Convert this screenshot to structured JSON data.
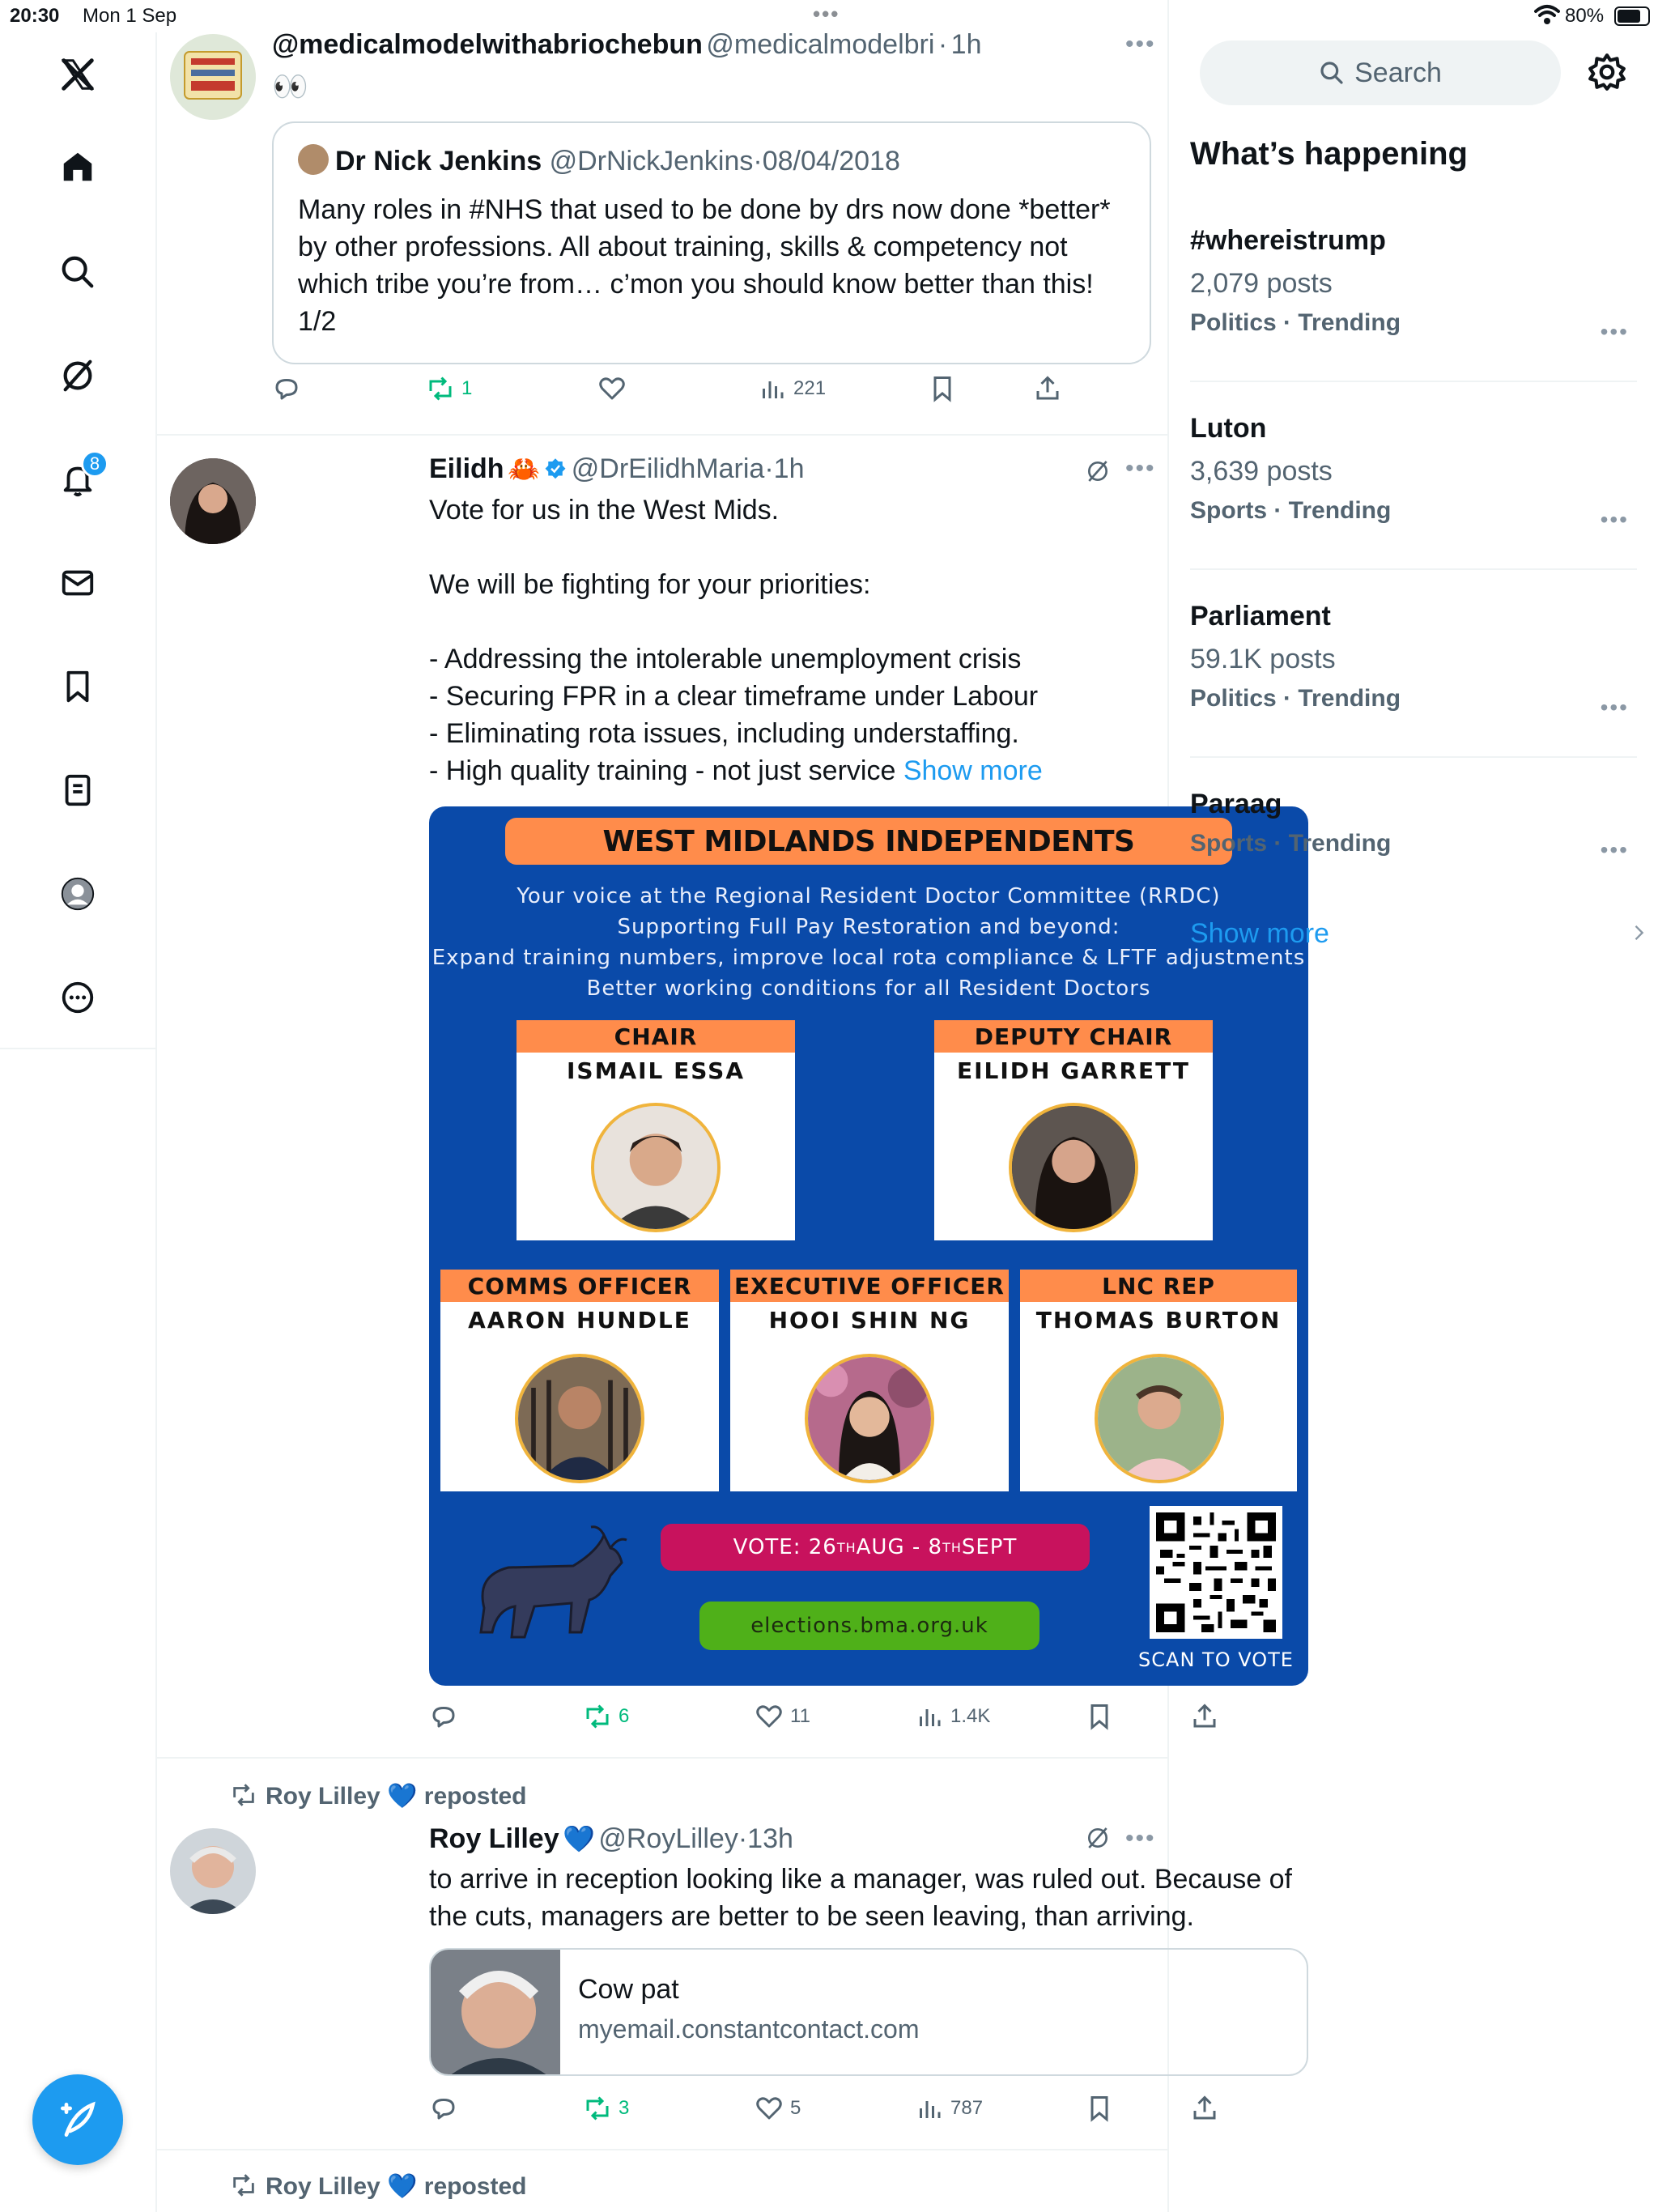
{
  "status": {
    "time": "20:30",
    "date": "Mon 1 Sep",
    "battery_pct": "80%",
    "battery_level": 0.8
  },
  "nav": {
    "notif_count": "8",
    "icons": [
      "x-logo-icon",
      "home-icon",
      "search-icon",
      "grok-icon",
      "bell-icon",
      "mail-icon",
      "bookmark-icon",
      "lists-icon",
      "profile-icon",
      "more-icon"
    ]
  },
  "tweets": [
    {
      "name": "@medicalmodelwithabriochebun",
      "handle": "@medicalmodelbri",
      "time": "1h",
      "text": "👀",
      "quote": {
        "name": "Dr Nick Jenkins",
        "handle": "@DrNickJenkins",
        "date": "08/04/2018",
        "text": "Many roles in #NHS that used to be done by drs now done *better* by other professions. All about training, skills & competency not which tribe you’re from… c’mon you should know better than this! 1/2"
      },
      "stats": {
        "replies": "",
        "reposts": "1",
        "likes": "",
        "views": "221"
      }
    },
    {
      "name": "Eilidh",
      "emoji": "🦀",
      "handle": "@DrEilidhMaria",
      "time": "1h",
      "text": "Vote for us in the West Mids.\n\nWe will be fighting for your priorities:\n\n- Addressing the intolerable unemployment crisis\n- Securing FPR in a clear timeframe under Labour\n- Eliminating rota issues, including understaffing.\n- High quality training - not just service ",
      "show_more": "Show more",
      "poster": {
        "title": "WEST MIDLANDS INDEPENDENTS",
        "subtitle_lines": [
          "Your voice at the Regional Resident Doctor Committee (RRDC)",
          "Supporting Full Pay Restoration and beyond:",
          "Expand training numbers, improve local rota compliance & LFTF adjustments",
          "Better working conditions for all Resident Doctors"
        ],
        "cards": [
          {
            "role": "CHAIR",
            "person": "ISMAIL ESSA"
          },
          {
            "role": "DEPUTY CHAIR",
            "person": "EILIDH GARRETT"
          },
          {
            "role": "COMMS OFFICER",
            "person": "AARON HUNDLE"
          },
          {
            "role": "EXECUTIVE OFFICER",
            "person": "HOOI SHIN NG"
          },
          {
            "role": "LNC REP",
            "person": "THOMAS BURTON"
          }
        ],
        "vote_prefix": "VOTE: 26",
        "vote_sup1": "TH",
        "vote_mid": " AUG - 8",
        "vote_sup2": "TH",
        "vote_suffix": " SEPT",
        "site": "elections.bma.org.uk",
        "scan": "SCAN TO VOTE"
      },
      "stats": {
        "replies": "",
        "reposts": "6",
        "likes": "11",
        "views": "1.4K"
      }
    },
    {
      "repost_by": "Roy Lilley",
      "repost_label": "reposted",
      "name": "Roy Lilley",
      "handle": "@RoyLilley",
      "time": "13h",
      "text": "to arrive in reception looking like a manager, was ruled out. Because of the cuts, managers are better to be seen leaving, than arriving.",
      "card": {
        "title": "Cow pat",
        "domain": "myemail.constantcontact.com"
      },
      "stats": {
        "replies": "",
        "reposts": "3",
        "likes": "5",
        "views": "787"
      }
    },
    {
      "repost_by": "Roy Lilley",
      "repost_label": "reposted"
    }
  ],
  "sidebar": {
    "search_placeholder": "Search",
    "heading": "What’s happening",
    "trends": [
      {
        "name": "#whereistrump",
        "posts": "2,079 posts",
        "category": "Politics · Trending"
      },
      {
        "name": "Luton",
        "posts": "3,639 posts",
        "category": "Sports · Trending"
      },
      {
        "name": "Parliament",
        "posts": "59.1K posts",
        "category": "Politics · Trending"
      },
      {
        "name": "Paraag",
        "posts": "",
        "category": "Sports · Trending"
      }
    ],
    "show_more": "Show more"
  },
  "colors": {
    "accent": "#1d9bf0",
    "repost_green": "#00ba7c",
    "poster_blue": "#0a4aa9",
    "poster_orange": "#ff8c4b"
  }
}
